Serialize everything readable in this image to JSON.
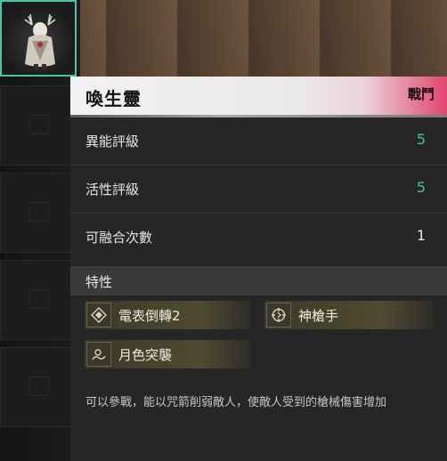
{
  "colors": {
    "accent_teal": "#3fc9a8",
    "header_pink": "#e0466f",
    "trait_gold": "#6c6444"
  },
  "inventory": {
    "slots": [
      {
        "icon": "character-portrait-icon",
        "selected": true
      },
      {
        "icon": "empty-slot-icon",
        "selected": false
      },
      {
        "icon": "empty-slot-icon",
        "selected": false
      },
      {
        "icon": "empty-slot-icon",
        "selected": false
      },
      {
        "icon": "empty-slot-icon",
        "selected": false
      }
    ]
  },
  "card": {
    "title": "喚生靈",
    "tag": "戰鬥",
    "stats": [
      {
        "label": "異能評級",
        "value": "5",
        "color": "#3fc9a8"
      },
      {
        "label": "活性評級",
        "value": "5",
        "color": "#3fc9a8"
      },
      {
        "label": "可融合次數",
        "value": "1",
        "color": "#e6e6e6"
      }
    ],
    "traits_heading": "特性",
    "traits": [
      {
        "name": "電表倒轉2",
        "icon": "diamond-icon"
      },
      {
        "name": "神槍手",
        "icon": "crosshair-icon"
      },
      {
        "name": "月色突襲",
        "icon": "moon-wave-icon"
      }
    ],
    "description": "可以參戰，能以咒箭削弱敵人，使敵人受到的槍械傷害增加"
  }
}
